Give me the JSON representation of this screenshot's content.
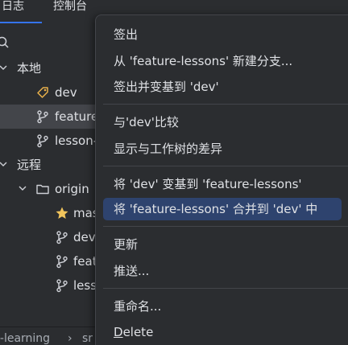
{
  "tabs": [
    "日志",
    "控制台"
  ],
  "tree": {
    "local_label": "本地",
    "local_branches": [
      "dev",
      "feature",
      "lesson-"
    ],
    "remote_label": "远程",
    "remote_name": "origin",
    "remote_branches": [
      "mas",
      "dev",
      "feat",
      "less"
    ]
  },
  "statusbar": {
    "breadcrumb_1": "i-learning",
    "separator": "›",
    "breadcrumb_2": "sr"
  },
  "menu": {
    "checkout": "签出",
    "new_branch": "从 'feature-lessons' 新建分支...",
    "checkout_rebase": "签出并变基到 'dev'",
    "compare": "与'dev'比较",
    "diff_worktree": "显示与工作树的差异",
    "rebase": "将 'dev' 变基到 'feature-lessons'",
    "merge": "将 'feature-lessons' 合并到 'dev' 中",
    "update": "更新",
    "push": "推送...",
    "rename": "重命名...",
    "delete_first": "D",
    "delete_rest": "elete"
  },
  "colors": {
    "accent": "#3574f0",
    "highlight": "#2e436e",
    "tag_icon": "#e8b04a",
    "star_icon": "#f2c55c"
  }
}
